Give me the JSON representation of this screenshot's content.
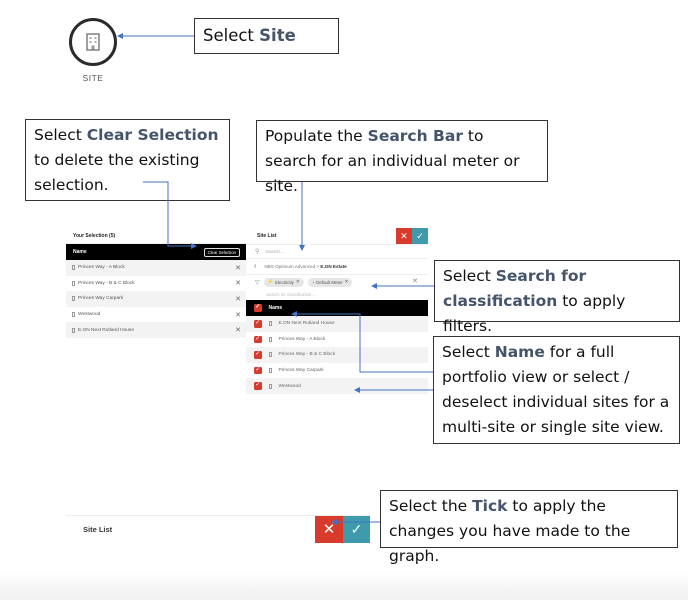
{
  "site_icon": {
    "icon": "building-icon",
    "label": "SITE"
  },
  "callouts": {
    "select_site": {
      "pre": "Select ",
      "highlight": "Site",
      "post": ""
    },
    "clear_selection": {
      "pre": "Select ",
      "highlight": "Clear Selection",
      "post": " to delete the existing selection."
    },
    "search_bar": {
      "pre": "Populate the ",
      "highlight": "Search Bar",
      "post": " to search for an individual meter or site."
    },
    "search_classification": {
      "pre": "Select ",
      "highlight": "Search for classification",
      "post": " to apply filters."
    },
    "name": {
      "pre": "Select ",
      "highlight": "Name",
      "post": " for a full portfolio view or select / deselect individual sites for a multi-site or single site view."
    },
    "tick": {
      "pre": "Select the ",
      "highlight": "Tick",
      "post": " to apply the changes you have made to the graph."
    }
  },
  "selection_panel": {
    "title": "Your Selection (5)",
    "column_header": "Name",
    "clear_button": "Clear Selection",
    "items": [
      {
        "label": "Princes Way - A Block"
      },
      {
        "label": "Princes Way - B & C Block"
      },
      {
        "label": "Princes Way Carpark"
      },
      {
        "label": "Westwood"
      },
      {
        "label": "E.ON Next Rutland House"
      }
    ]
  },
  "site_list_panel": {
    "title": "Site List",
    "search_placeholder": "Search...",
    "breadcrumb": {
      "parent": "NBS Optimum Advanced",
      "separator": ">",
      "current": "E.ON Estate"
    },
    "filters": [
      {
        "label": "Electricity",
        "icon": "bolt-icon"
      },
      {
        "label": "Default Meter",
        "icon": "meter-icon"
      }
    ],
    "classification_placeholder": "Search for classification...",
    "column_header": "Name",
    "items": [
      {
        "label": "E.ON Next Rutland House",
        "checked": true
      },
      {
        "label": "Princes Way - A Block",
        "checked": true
      },
      {
        "label": "Princes Way - B & C Block",
        "checked": true
      },
      {
        "label": "Princes Way Carpark",
        "checked": true
      },
      {
        "label": "Westwood",
        "checked": true
      }
    ]
  },
  "bottom_bar": {
    "title": "Site List"
  },
  "colors": {
    "cancel": "#d83a2c",
    "apply": "#3f9aab",
    "highlight_text": "#44546a",
    "connector": "#4472c4"
  }
}
